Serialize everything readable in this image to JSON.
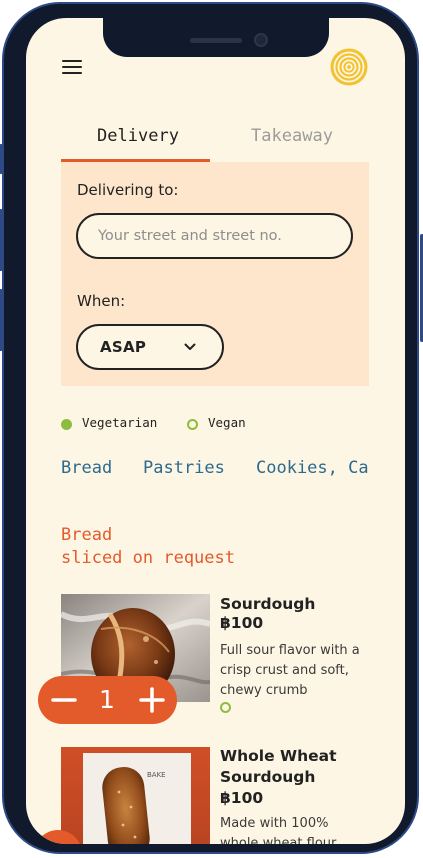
{
  "header": {
    "menu_icon": "hamburger-menu-icon",
    "logo_icon": "concentric-circles-logo"
  },
  "tabs": [
    {
      "label": "Delivery",
      "active": true
    },
    {
      "label": "Takeaway",
      "active": false
    }
  ],
  "delivery": {
    "delivering_label": "Delivering to:",
    "address_placeholder": "Your street and street no.",
    "address_value": "",
    "when_label": "When:",
    "when_value": "ASAP"
  },
  "legend": {
    "vegetarian": "Vegetarian",
    "vegan": "Vegan"
  },
  "categories": [
    "Bread",
    "Pastries",
    "Cookies, Ca"
  ],
  "section": {
    "title": "Bread",
    "subtitle": "sliced on request"
  },
  "products": [
    {
      "name": "Sourdough",
      "price": "฿100",
      "description": "Full sour flavor with a crisp crust and soft, chewy crumb",
      "diet": "vegan",
      "quantity": "1"
    },
    {
      "name_line1": "Whole Wheat",
      "name_line2": "Sourdough",
      "price": "฿100",
      "description_visible": "Made with 100%",
      "description_cut": "whole wheat flour"
    }
  ],
  "colors": {
    "accent": "#e35a2b",
    "background": "#fef6e4",
    "panel": "#fde6cc",
    "link": "#2c6a8e",
    "veg_green": "#8cbd3f",
    "logo": "#f2c230"
  }
}
